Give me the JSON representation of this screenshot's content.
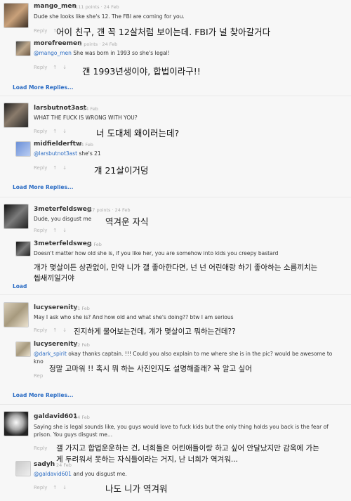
{
  "comments": [
    {
      "user": "mango_men",
      "meta": "4111 points · 24 Feb",
      "text": "Dude she looks like she's 12. The FBI are coming for you.",
      "mention": "",
      "actions": [
        "Reply",
        "↑",
        "↓"
      ],
      "ko": "어이 친구, 걘 꼭 12살처럼 보이는데. FBI가 널 찾아갈거다"
    },
    {
      "user": "morefreemen",
      "meta": "2 points · 24 Feb",
      "text": " She was born in 1993 so she's legal!",
      "mention": "@mango_men",
      "actions": [
        "Reply",
        "↑",
        "↓"
      ],
      "ko": "걘 1993년생이야, 합법이라구!!"
    },
    {
      "user": "larsbutnot3ast",
      "meta": "24 Feb",
      "text": "WHAT THE FUCK IS WRONG WITH YOU?",
      "mention": "",
      "actions": [
        "Reply",
        "↑",
        "↓"
      ],
      "ko": "너 도대체 왜이러는데?"
    },
    {
      "user": "midfielderftw",
      "meta": "24 Feb",
      "text": " she's 21",
      "mention": "@larsbutnot3ast",
      "actions": [
        "Reply",
        "↑",
        "↓"
      ],
      "ko": "걔 21살이거덩"
    },
    {
      "user": "3meterfeldsweg",
      "meta": "257 points · 24 Feb",
      "text": "Dude, you disgust me",
      "mention": "",
      "actions": [
        "Reply",
        "↑",
        "↓"
      ],
      "ko": "역겨운 자식"
    },
    {
      "user": "3meterfeldsweg",
      "meta": "24 Feb",
      "text": "Doesn't matter how old she is, if you like her, you are somehow into kids you creepy bastard",
      "mention": "",
      "actions": [
        "Reply"
      ],
      "ko": "개가 몇살이든 상관없이, 만약 니가 걜 좋아한다면, 넌 넌 어린애랑 하기 좋아하는 소름끼치는",
      "ko2": "씹새끼일거야"
    },
    {
      "user": "lucyserenity",
      "meta": "21 Feb",
      "text": "May I ask who she is? And how old and what she's doing?? btw I am serious",
      "mention": "",
      "actions": [
        "Reply",
        "↑",
        "↓"
      ],
      "ko": "진지하게 물어보는건데, 걔가 몇살이고 뭐하는건데??"
    },
    {
      "user": "lucyserenity",
      "meta": "22 Feb",
      "text": " okay thanks captain. !!! Could you also explain to me where she is in the pic? would be awesome to",
      "mention": "@dark_spirit",
      "text2": "kno",
      "actions": [
        "Rep"
      ],
      "ko": "정말 고마워 !! 혹시 뭐 하는 사진인지도 설명해줄래? 꼭 알고 싶어"
    },
    {
      "user": "galdavid601",
      "meta": "24 Feb",
      "text": "Saying she is legal sounds like, you guys would love to fuck kids but the only thing holds you back is the fear of",
      "text2": "prison. You guys disgust me...",
      "mention": "",
      "actions": [
        "Reply"
      ],
      "ko": "걜 가지고 합법운운하는 건, 너희들은 어린애들이랑 하고 싶어 안달났지만 감옥에 가는",
      "ko2": "게 두려워서 못하는 자식들이라는 거지, 난 너희가 역겨워..."
    },
    {
      "user": "sadyh",
      "meta": "24 Feb",
      "text": " and you disgust me.",
      "mention": "@galdavid601",
      "actions": [
        "Reply",
        "↑",
        "↓"
      ],
      "ko": "나도 니가 역겨워"
    }
  ],
  "load_more": [
    "Load More Replies...",
    "Load More Replies...",
    "Load More Replies...",
    "Load More Replies...",
    "Load"
  ]
}
